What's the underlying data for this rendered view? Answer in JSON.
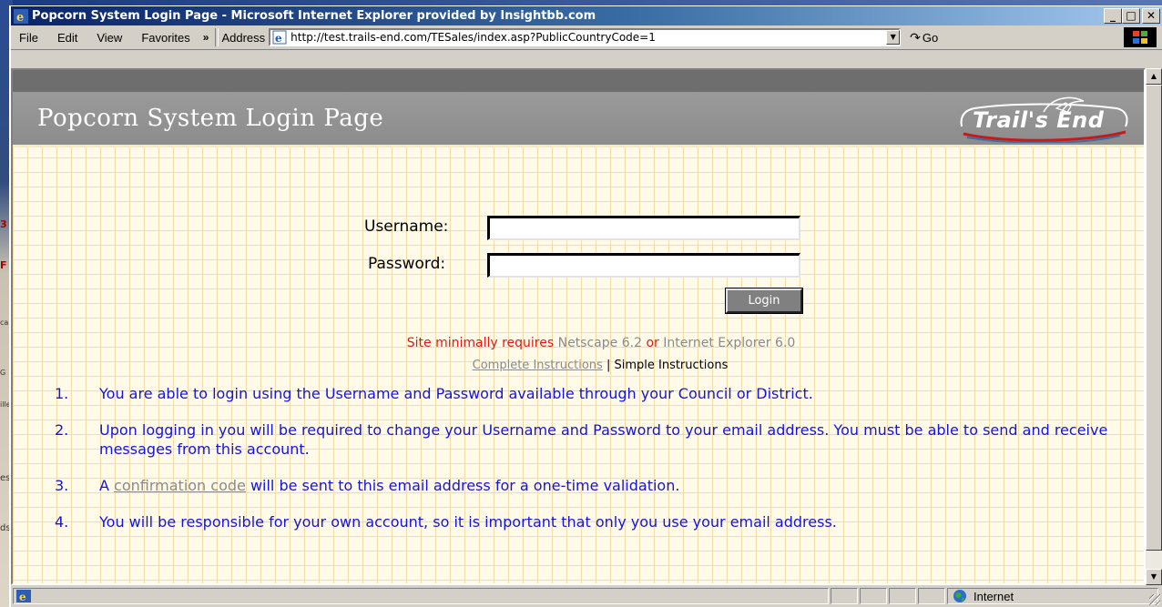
{
  "window": {
    "title": "Popcorn System Login Page - Microsoft Internet Explorer provided by Insightbb.com",
    "caption_buttons": {
      "minimize": "_",
      "maximize": "□",
      "close": "✕"
    }
  },
  "menubar": {
    "items": [
      "File",
      "Edit",
      "View",
      "Favorites"
    ],
    "chevron": "»",
    "address_label": "Address",
    "url": "http://test.trails-end.com/TESales/index.asp?PublicCountryCode=1",
    "go_label": "Go"
  },
  "page": {
    "header_title": "Popcorn System Login Page",
    "logo_text": "Trail's End",
    "form": {
      "username_label": "Username:",
      "password_label": "Password:",
      "username_value": "",
      "password_value": "",
      "login_label": "Login"
    },
    "requirements": {
      "prefix": "Site minimally requires",
      "browser1": "Netscape 6.2",
      "or": "or",
      "browser2": "Internet Explorer 6.0"
    },
    "instructions": {
      "complete": "Complete Instructions",
      "sep": "|",
      "simple": "Simple Instructions"
    },
    "steps": [
      {
        "num": "1.",
        "text": "You are able to login using the Username and Password available through your Council or District."
      },
      {
        "num": "2.",
        "text": "Upon logging in you will be required to change your Username and Password to your email address. You must be able to send and receive messages from this account."
      },
      {
        "num": "3.",
        "pre": "A",
        "link": "confirmation code",
        "post": "will be sent to this email address for a one-time validation."
      },
      {
        "num": "4.",
        "text": "You will be responsible for your own account, so it is important that only you use your email address."
      }
    ]
  },
  "statusbar": {
    "zone": "Internet"
  },
  "colors": {
    "title_gradient_start": "#0a246a",
    "header_gray": "#8c8c8c",
    "step_text_blue": "#1414e0",
    "requirement_red": "#e01818",
    "link_gray": "#8a8a8a"
  }
}
